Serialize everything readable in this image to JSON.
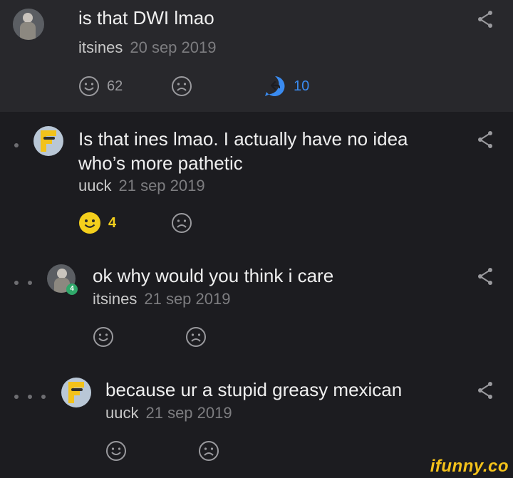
{
  "comments": [
    {
      "text": "is that DWI lmao",
      "user": "itsines",
      "date": "20 sep 2019",
      "likes": "62",
      "replies": "10"
    },
    {
      "text_line1": "Is that ines lmao. I actually have no idea",
      "text_line2": "who’s more pathetic",
      "user": "uuck",
      "date": "21 sep 2019",
      "likes": "4"
    },
    {
      "text": "ok why would you think i care",
      "user": "itsines",
      "date": "21 sep 2019",
      "avatar_badge": "4"
    },
    {
      "text": "because ur a stupid greasy mexican",
      "user": "uuck",
      "date": "21 sep 2019"
    }
  ],
  "watermark": "ifunny.co",
  "colors": {
    "reply_accent": "#3a8bf0",
    "liked_emoji": "#f4cf1c",
    "badge": "#2fa86a",
    "highlight_bg": "#28282c",
    "bg": "#1c1c20"
  }
}
